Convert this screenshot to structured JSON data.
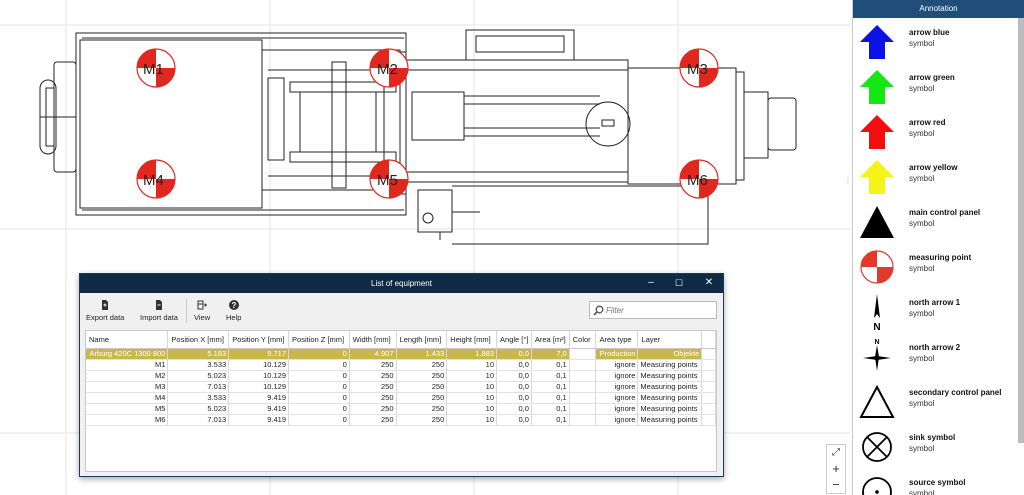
{
  "canvas": {
    "measuring_points": [
      {
        "label": "M1"
      },
      {
        "label": "M2"
      },
      {
        "label": "M3"
      },
      {
        "label": "M4"
      },
      {
        "label": "M5"
      },
      {
        "label": "M6"
      }
    ]
  },
  "annotation_panel": {
    "title": "Annotation",
    "items": [
      {
        "name": "arrow blue",
        "type": "symbol",
        "icon": "arrow-blue-icon",
        "color": "#0a12e6"
      },
      {
        "name": "arrow green",
        "type": "symbol",
        "icon": "arrow-green-icon",
        "color": "#13e813"
      },
      {
        "name": "arrow red",
        "type": "symbol",
        "icon": "arrow-red-icon",
        "color": "#f20e0e"
      },
      {
        "name": "arrow yellow",
        "type": "symbol",
        "icon": "arrow-yellow-icon",
        "color": "#f4f41a"
      },
      {
        "name": "main control panel",
        "type": "symbol",
        "icon": "main-control-panel-icon"
      },
      {
        "name": "measuring point",
        "type": "symbol",
        "icon": "measuring-point-icon",
        "color": "#e03a2b"
      },
      {
        "name": "north arrow 1",
        "type": "symbol",
        "icon": "north-arrow-1-icon"
      },
      {
        "name": "north arrow 2",
        "type": "symbol",
        "icon": "north-arrow-2-icon"
      },
      {
        "name": "secondary control panel",
        "type": "symbol",
        "icon": "secondary-control-panel-icon"
      },
      {
        "name": "sink symbol",
        "type": "symbol",
        "icon": "sink-symbol-icon"
      },
      {
        "name": "source symbol",
        "type": "symbol",
        "icon": "source-symbol-icon"
      }
    ],
    "north_letter": "N"
  },
  "zoom": {
    "fit": "⤢",
    "plus": "+",
    "minus": "−"
  },
  "equipment_window": {
    "title": "List of equipment",
    "minimize": "‒",
    "maximize": "☐",
    "close": "✕",
    "toolbar": {
      "export_label": "Export data",
      "import_label": "Import data",
      "view_label": "View",
      "help_label": "Help"
    },
    "filter_placeholder": "Filter",
    "columns": [
      "Name",
      "Position X [mm]",
      "Position Y [mm]",
      "Position Z [mm]",
      "Width [mm]",
      "Length [mm]",
      "Height [mm]",
      "Angle [°]",
      "Area [m²]",
      "Color",
      "Area type",
      "Layer"
    ],
    "rows": [
      {
        "name": "Arburg 420C 1300 800",
        "x": "5.183",
        "y": "9.717",
        "z": "0",
        "width": "4.907",
        "length": "1.433",
        "height": "1.883",
        "angle": "0,0",
        "area": "7,0",
        "color": "",
        "area_type": "Production",
        "layer": "Objekte",
        "selected": true
      },
      {
        "name": "M1",
        "x": "3.533",
        "y": "10.129",
        "z": "0",
        "width": "250",
        "length": "250",
        "height": "10",
        "angle": "0,0",
        "area": "0,1",
        "color": "",
        "area_type": "ignore",
        "layer": "Measuring points"
      },
      {
        "name": "M2",
        "x": "5.023",
        "y": "10.129",
        "z": "0",
        "width": "250",
        "length": "250",
        "height": "10",
        "angle": "0,0",
        "area": "0,1",
        "color": "",
        "area_type": "ignore",
        "layer": "Measuring points"
      },
      {
        "name": "M3",
        "x": "7.013",
        "y": "10.129",
        "z": "0",
        "width": "250",
        "length": "250",
        "height": "10",
        "angle": "0,0",
        "area": "0,1",
        "color": "",
        "area_type": "ignore",
        "layer": "Measuring points"
      },
      {
        "name": "M4",
        "x": "3.533",
        "y": "9.419",
        "z": "0",
        "width": "250",
        "length": "250",
        "height": "10",
        "angle": "0,0",
        "area": "0,1",
        "color": "",
        "area_type": "ignore",
        "layer": "Measuring points"
      },
      {
        "name": "M5",
        "x": "5.023",
        "y": "9.419",
        "z": "0",
        "width": "250",
        "length": "250",
        "height": "10",
        "angle": "0,0",
        "area": "0,1",
        "color": "",
        "area_type": "ignore",
        "layer": "Measuring points"
      },
      {
        "name": "M6",
        "x": "7.013",
        "y": "9.419",
        "z": "0",
        "width": "250",
        "length": "250",
        "height": "10",
        "angle": "0,0",
        "area": "0,1",
        "color": "",
        "area_type": "ignore",
        "layer": "Measuring points"
      }
    ]
  }
}
